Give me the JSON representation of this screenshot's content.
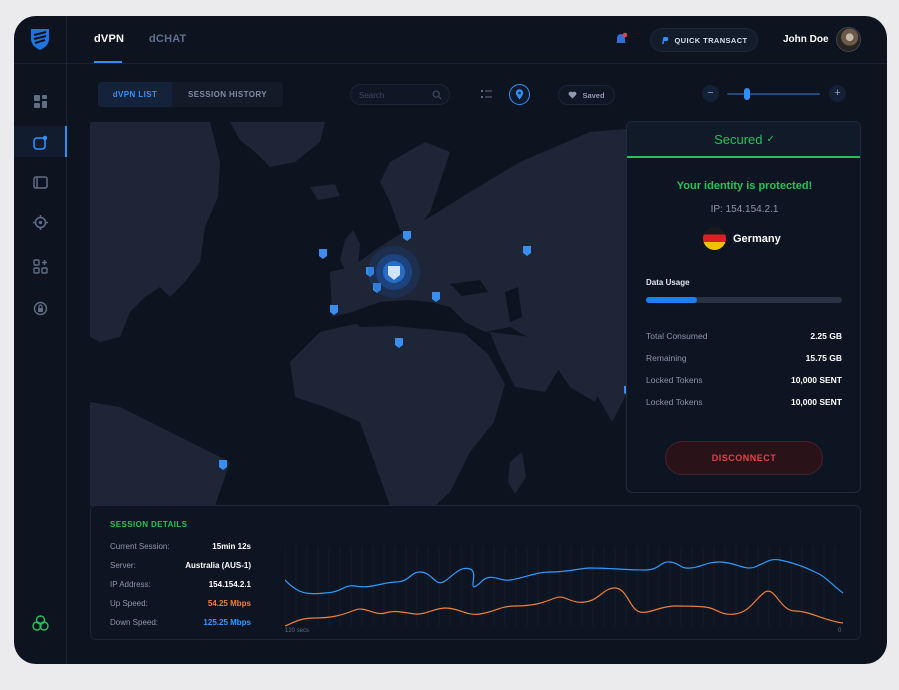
{
  "nav": {
    "tabs": [
      "dVPN",
      "dCHAT"
    ]
  },
  "header": {
    "quick_transact": "QUICK TRANSACT",
    "user_name": "John Doe"
  },
  "sidebar": {
    "icons": [
      "dashboard-icon",
      "vpn-icon",
      "wallet-icon",
      "network-icon",
      "apps-icon",
      "security-icon"
    ]
  },
  "subtabs": [
    "dVPN LIST",
    "SESSION HISTORY"
  ],
  "search": {
    "placeholder": "Search"
  },
  "saved": {
    "label": "Saved"
  },
  "zoom": {
    "level": 0.22
  },
  "status": {
    "title": "Secured",
    "check": "✓",
    "message": "Your identity is protected!",
    "ip_label": "IP:",
    "ip": "154.154.2.1",
    "country": "Germany",
    "data_usage_label": "Data Usage",
    "data_usage_fraction": 0.26,
    "rows": [
      {
        "label": "Total Consumed",
        "value": "2.25 GB"
      },
      {
        "label": "Remaining",
        "value": "15.75 GB"
      },
      {
        "label": "Locked Tokens",
        "value": "10,000 SENT"
      },
      {
        "label": "Locked Tokens",
        "value": "10,000 SENT"
      }
    ],
    "disconnect": "DISCONNECT"
  },
  "session": {
    "title": "SESSION DETAILS",
    "rows": [
      {
        "label": "Current Session:",
        "value": "15min 12s"
      },
      {
        "label": "Server:",
        "value": "Australia (AUS-1)"
      },
      {
        "label": "IP Address:",
        "value": "154.154.2.1"
      },
      {
        "label": "Up Speed:",
        "value": "54.25 Mbps"
      },
      {
        "label": "Down Speed:",
        "value": "125.25 Mbps"
      }
    ],
    "graph_x_start": "120 secs",
    "graph_x_end": "0",
    "colors": {
      "up": "#ee7f3c",
      "down": "#2f9bff"
    }
  },
  "colors": {
    "accent": "#2f8fff",
    "secured": "#22c35a",
    "danger": "#e4404c"
  }
}
